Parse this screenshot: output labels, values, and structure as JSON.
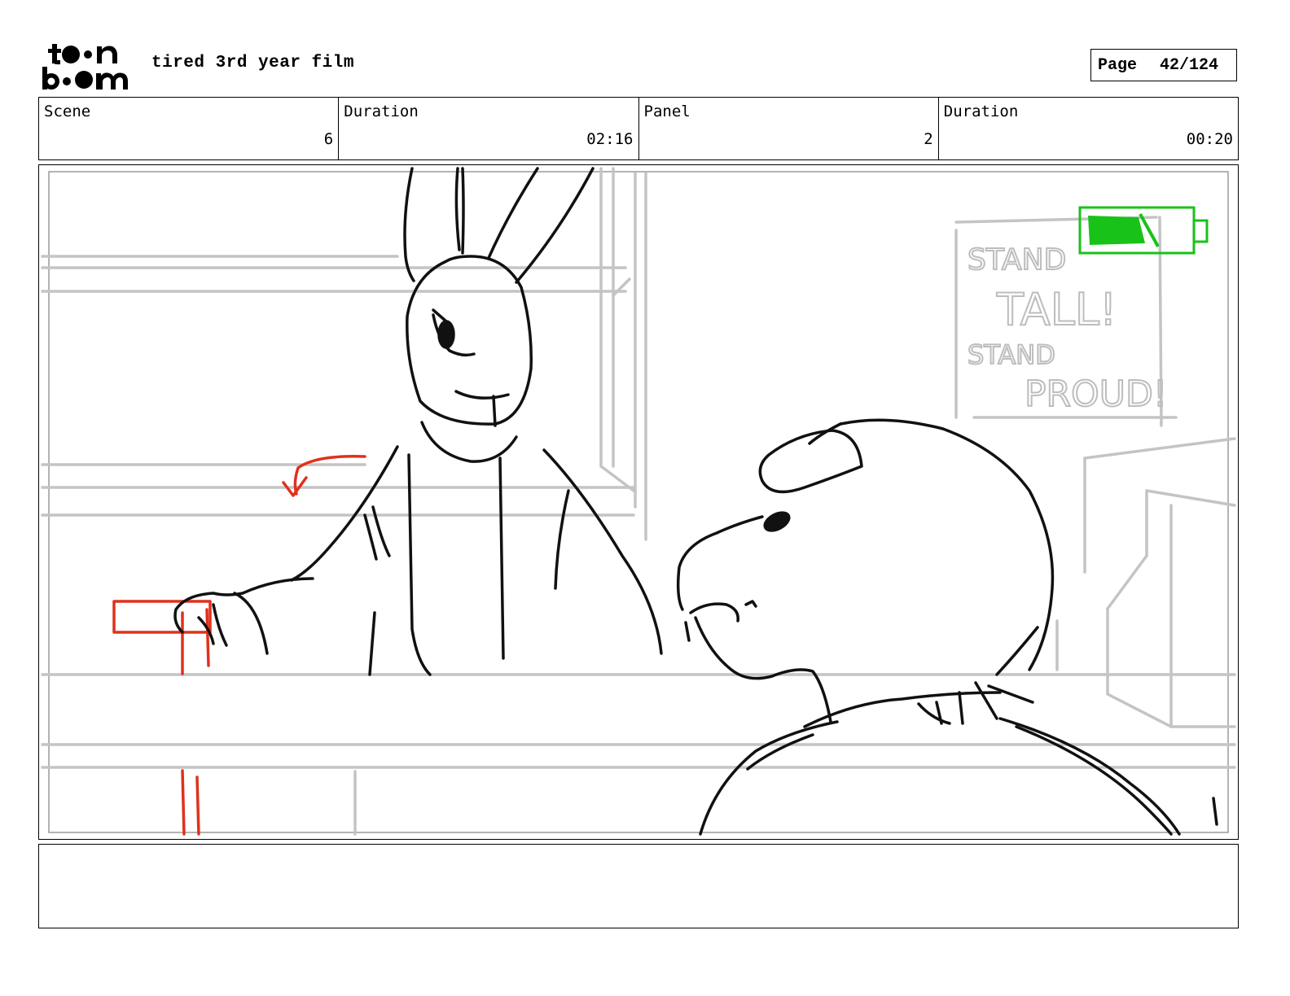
{
  "header": {
    "logo_text": "toon boom",
    "project_title": "tired 3rd year film",
    "page_label": "Page",
    "page_value": "42/124"
  },
  "info": {
    "scene_label": "Scene",
    "scene_value": "6",
    "scene_duration_label": "Duration",
    "scene_duration_value": "02:16",
    "panel_label": "Panel",
    "panel_value": "2",
    "panel_duration_label": "Duration",
    "panel_duration_value": "00:20"
  },
  "panel": {
    "poster_text": [
      "STAND",
      "TALL!",
      "STAND",
      "PROUD!"
    ],
    "colors": {
      "sketch": "#111111",
      "background_lines": "#c4c4c4",
      "annotation": "#e0311c",
      "battery": "#19c219"
    }
  },
  "notes": {
    "text": ""
  }
}
